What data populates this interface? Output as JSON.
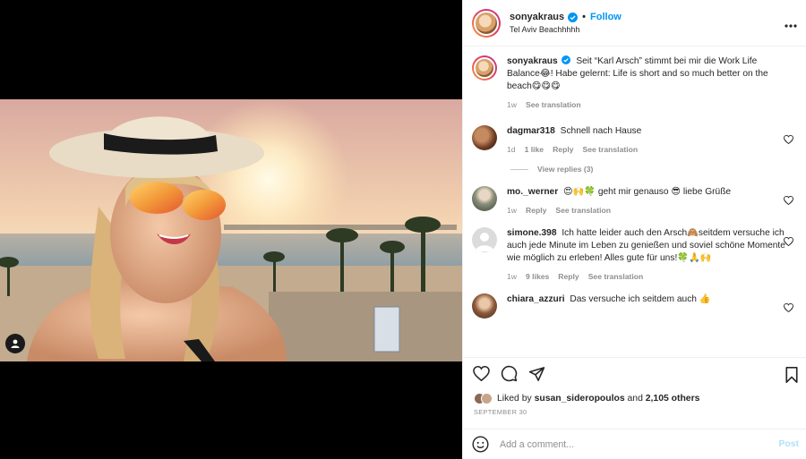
{
  "post": {
    "username": "sonyakraus",
    "follow_label": "Follow",
    "location": "Tel Aviv Beachhhhh",
    "caption": {
      "username": "sonyakraus",
      "text": "Seit “Karl Arsch” stimmt bei mir die Work Life Balance😂! Habe gelernt: Life is short and so much better on the beach😋😋😋",
      "time": "1w",
      "translate": "See translation"
    }
  },
  "comments": [
    {
      "username": "dagmar318",
      "text": "Schnell nach Hause",
      "time": "1d",
      "likes": "1 like",
      "reply": "Reply",
      "translate": "See translation",
      "replies": "View replies (3)"
    },
    {
      "username": "mo._werner",
      "text": "😍🙌🍀 geht mir genauso 😎 liebe Grüße",
      "time": "1w",
      "reply": "Reply",
      "translate": "See translation"
    },
    {
      "username": "simone.398",
      "text": "Ich hatte leider auch den Arsch🙈seitdem versuche ich auch jede Minute im Leben zu genießen und soviel schöne Momente wie möglich zu erleben! Alles gute für uns!🍀🙏🙌",
      "time": "1w",
      "likes": "9 likes",
      "reply": "Reply",
      "translate": "See translation"
    },
    {
      "username": "chiara_azzuri",
      "text": "Das versuche ich seitdem auch 👍"
    }
  ],
  "likes": {
    "prefix": "Liked by",
    "user": "susan_sideropoulos",
    "joiner": "and",
    "others": "2,105 others"
  },
  "date": "SEPTEMBER 30",
  "add_comment": {
    "placeholder": "Add a comment...",
    "post_label": "Post"
  },
  "icons": {
    "verified": "verified-badge-icon",
    "more": "more-options-icon",
    "heart": "heart-icon",
    "comment": "comment-icon",
    "share": "share-icon",
    "save": "bookmark-icon",
    "emoji": "emoji-icon",
    "tag": "user-tag-icon"
  },
  "colors": {
    "accent": "#0095f6",
    "text": "#262626",
    "muted": "#8e8e8e",
    "post_disabled": "#b2dffc"
  }
}
